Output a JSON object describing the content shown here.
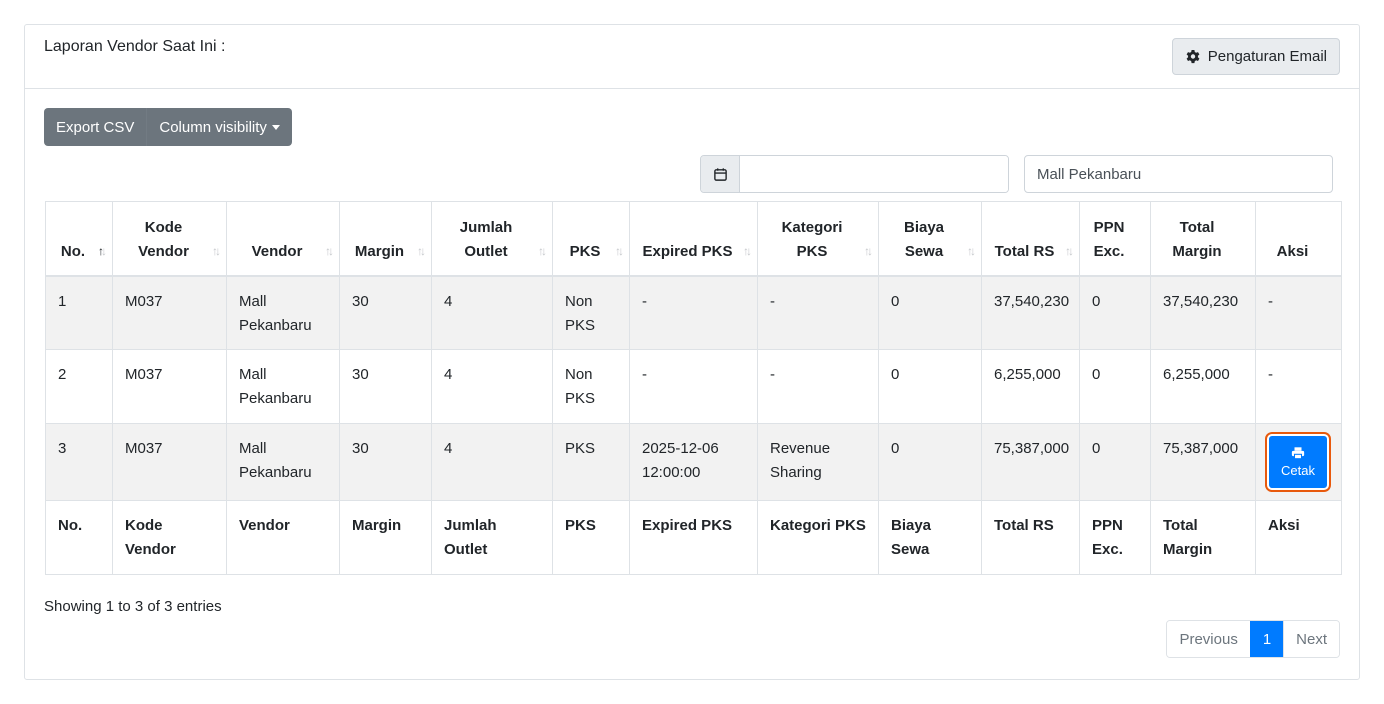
{
  "header": {
    "title": "Laporan Vendor Saat Ini :",
    "settings_label": "Pengaturan Email",
    "settings_icon": "gear-icon"
  },
  "toolbar": {
    "export_label": "Export CSV",
    "column_visibility_label": "Column visibility"
  },
  "filters": {
    "date_value": "",
    "date_icon": "calendar-icon",
    "vendor_value": "Mall Pekanbaru"
  },
  "table": {
    "columns": [
      "No.",
      "Kode Vendor",
      "Vendor",
      "Margin",
      "Jumlah Outlet",
      "PKS",
      "Expired PKS",
      "Kategori PKS",
      "Biaya Sewa",
      "Total RS",
      "PPN Exc.",
      "Total Margin",
      "Aksi"
    ],
    "rows": [
      [
        "1",
        "M037",
        "Mall Pekanbaru",
        "30",
        "4",
        "Non PKS",
        "-",
        "-",
        "0",
        "37,540,230",
        "0",
        "37,540,230",
        "-"
      ],
      [
        "2",
        "M037",
        "Mall Pekanbaru",
        "30",
        "4",
        "Non PKS",
        "-",
        "-",
        "0",
        "6,255,000",
        "0",
        "6,255,000",
        "-"
      ],
      [
        "3",
        "M037",
        "Mall Pekanbaru",
        "30",
        "4",
        "PKS",
        "2025-12-06 12:00:00",
        "Revenue Sharing",
        "0",
        "75,387,000",
        "0",
        "75,387,000",
        ""
      ]
    ],
    "print_label": "Cetak",
    "print_icon": "printer-icon"
  },
  "info": "Showing 1 to 3 of 3 entries",
  "pagination": {
    "previous": "Previous",
    "current": "1",
    "next": "Next"
  },
  "colors": {
    "primary": "#007bff",
    "secondary": "#6c757d",
    "focus_ring": "#e8590c",
    "stripe": "#f2f2f2"
  }
}
